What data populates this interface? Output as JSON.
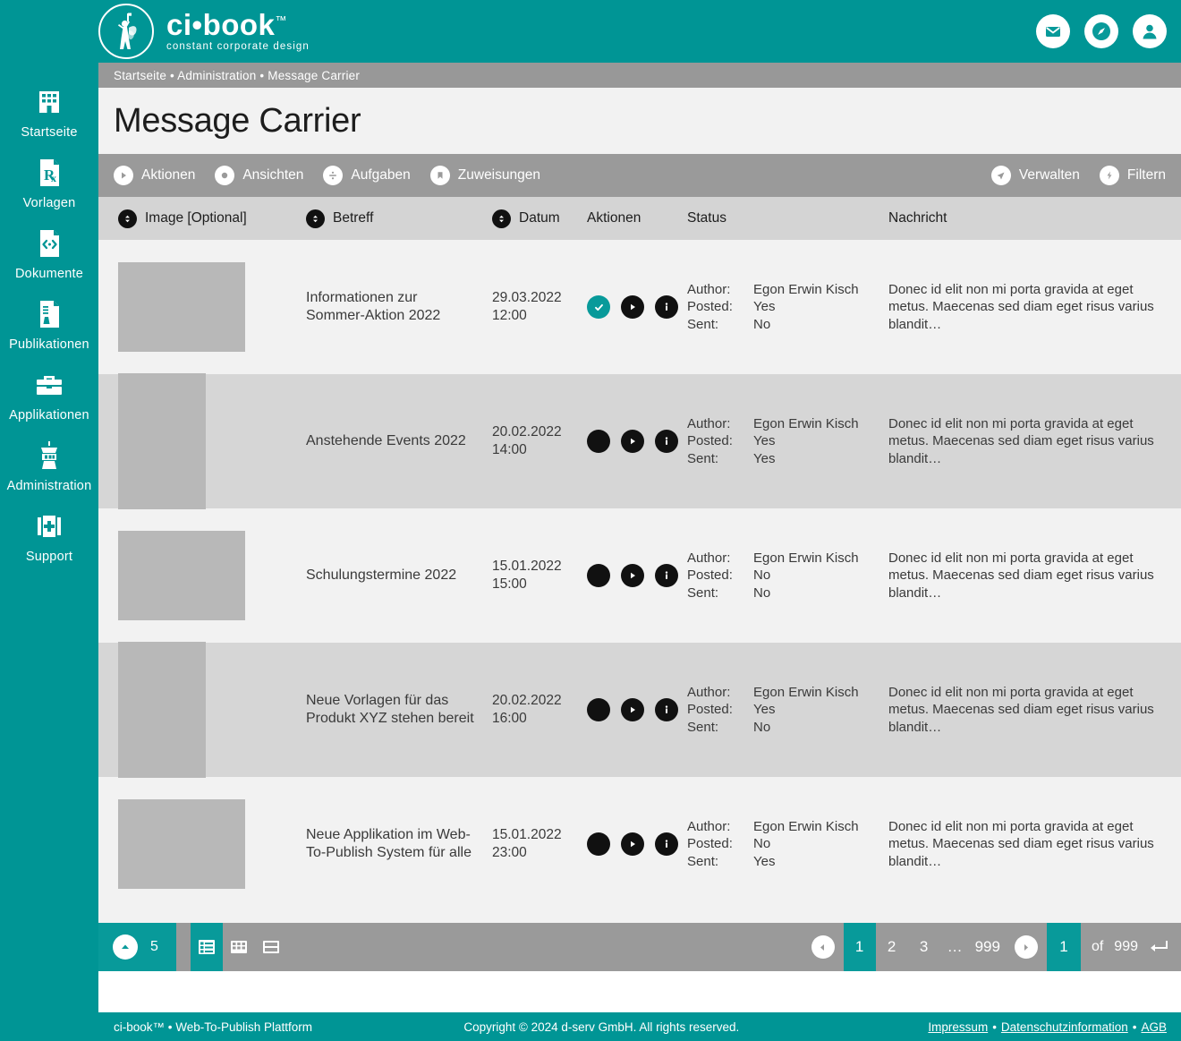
{
  "brand": {
    "name": "ci•book",
    "tm": "™",
    "tagline": "constant corporate design"
  },
  "header": {
    "icons": [
      {
        "name": "mail-icon",
        "label": "Nachrichten"
      },
      {
        "name": "compass-icon",
        "label": "Navigator"
      },
      {
        "name": "user-icon",
        "label": "Benutzerkonto"
      }
    ]
  },
  "sidebar": {
    "items": [
      {
        "label": "Startseite",
        "icon": "building-icon"
      },
      {
        "label": "Vorlagen",
        "icon": "prescription-document-icon"
      },
      {
        "label": "Dokumente",
        "icon": "code-document-icon"
      },
      {
        "label": "Publikationen",
        "icon": "publication-document-icon"
      },
      {
        "label": "Applikationen",
        "icon": "toolbox-icon"
      },
      {
        "label": "Administration",
        "icon": "control-tower-icon"
      },
      {
        "label": "Support",
        "icon": "first-aid-kit-icon"
      }
    ]
  },
  "breadcrumb": "Startseite • Administration • Message Carrier",
  "page_title": "Message Carrier",
  "toolbar": {
    "left": [
      {
        "label": "Aktionen",
        "icon": "play-icon"
      },
      {
        "label": "Ansichten",
        "icon": "eye-circle-icon"
      },
      {
        "label": "Aufgaben",
        "icon": "divide-icon"
      },
      {
        "label": "Zuweisungen",
        "icon": "bookmark-icon"
      }
    ],
    "right": [
      {
        "label": "Verwalten",
        "icon": "paper-plane-icon"
      },
      {
        "label": "Filtern",
        "icon": "bolt-icon"
      }
    ]
  },
  "table": {
    "columns": [
      {
        "label": "Image [Optional]",
        "sortable": true
      },
      {
        "label": "Betreff",
        "sortable": true
      },
      {
        "label": "Datum",
        "sortable": true
      },
      {
        "label": "Aktionen",
        "sortable": false
      },
      {
        "label": "Status",
        "sortable": false
      },
      {
        "label": "Nachricht",
        "sortable": false
      }
    ],
    "status_labels": {
      "author": "Author:",
      "posted": "Posted:",
      "sent": "Sent:"
    },
    "rows": [
      {
        "thumb": "landscape",
        "subject_line1": "Informationen zur",
        "subject_line2": "Sommer-Aktion 2022",
        "date": "29.03.2022",
        "time": "12:00",
        "actions": [
          {
            "name": "check-icon",
            "style": "teal"
          },
          {
            "name": "play-icon",
            "style": "plain"
          },
          {
            "name": "info-icon",
            "style": "plain"
          }
        ],
        "author": "Egon Erwin Kisch",
        "posted": "Yes",
        "sent": "No",
        "message": "Donec id elit non mi porta gravida at eget metus. Maecenas sed diam eget risus varius blandit…"
      },
      {
        "thumb": "portrait",
        "subject_line1": "Anstehende Events 2022",
        "subject_line2": "",
        "date": "20.02.2022",
        "time": "14:00",
        "actions": [
          {
            "name": "dot-icon",
            "style": "plain"
          },
          {
            "name": "play-icon",
            "style": "plain"
          },
          {
            "name": "info-icon",
            "style": "plain"
          }
        ],
        "author": "Egon Erwin Kisch",
        "posted": "Yes",
        "sent": "Yes",
        "message": "Donec id elit non mi porta gravida at eget metus. Maecenas sed diam eget risus varius blandit…"
      },
      {
        "thumb": "landscape",
        "subject_line1": "Schulungstermine 2022",
        "subject_line2": "",
        "date": "15.01.2022",
        "time": "15:00",
        "actions": [
          {
            "name": "dot-icon",
            "style": "plain"
          },
          {
            "name": "play-icon",
            "style": "plain"
          },
          {
            "name": "info-icon",
            "style": "plain"
          }
        ],
        "author": "Egon Erwin Kisch",
        "posted": "No",
        "sent": "No",
        "message": "Donec id elit non mi porta gravida at eget metus. Maecenas sed diam eget risus varius blandit…"
      },
      {
        "thumb": "portrait",
        "subject_line1": "Neue Vorlagen für das",
        "subject_line2": "Produkt XYZ stehen bereit",
        "date": "20.02.2022",
        "time": "16:00",
        "actions": [
          {
            "name": "dot-icon",
            "style": "plain"
          },
          {
            "name": "play-icon",
            "style": "plain"
          },
          {
            "name": "info-icon",
            "style": "plain"
          }
        ],
        "author": "Egon Erwin Kisch",
        "posted": "Yes",
        "sent": "No",
        "message": "Donec id elit non mi porta gravida at eget metus. Maecenas sed diam eget risus varius blandit…"
      },
      {
        "thumb": "landscape",
        "subject_line1": "Neue Applikation im Web-",
        "subject_line2": "To-Publish System für alle",
        "date": "15.01.2022",
        "time": "23:00",
        "actions": [
          {
            "name": "dot-icon",
            "style": "plain"
          },
          {
            "name": "play-icon",
            "style": "plain"
          },
          {
            "name": "info-icon",
            "style": "plain"
          }
        ],
        "author": "Egon Erwin Kisch",
        "posted": "No",
        "sent": "Yes",
        "message": "Donec id elit non mi porta gravida at eget metus. Maecenas sed diam eget risus varius blandit…"
      }
    ]
  },
  "pager": {
    "rows_per_page": "5",
    "view_modes": [
      {
        "name": "list-view-icon",
        "active": true
      },
      {
        "name": "grid-view-icon",
        "active": false
      },
      {
        "name": "split-view-icon",
        "active": false
      }
    ],
    "pages": [
      "1",
      "2",
      "3"
    ],
    "ellipsis": "…",
    "last_page": "999",
    "current_page": "1",
    "of_label": "of",
    "total_pages": "999"
  },
  "footer": {
    "left": "ci-book™ • Web-To-Publish Plattform",
    "center": "Copyright © 2024 d-serv GmbH. All rights reserved.",
    "links": [
      "Impressum",
      "Datenschutzinformation",
      "AGB"
    ],
    "link_sep": "•"
  },
  "colors": {
    "brand_teal": "#009595",
    "accent_teal": "#089a9a",
    "toolbar_gray": "#9a9a9a",
    "header_gray": "#d4d4d4",
    "row_odd": "#f2f2f2",
    "row_even": "#d6d6d6",
    "thumb_gray": "#b8b8b8"
  }
}
